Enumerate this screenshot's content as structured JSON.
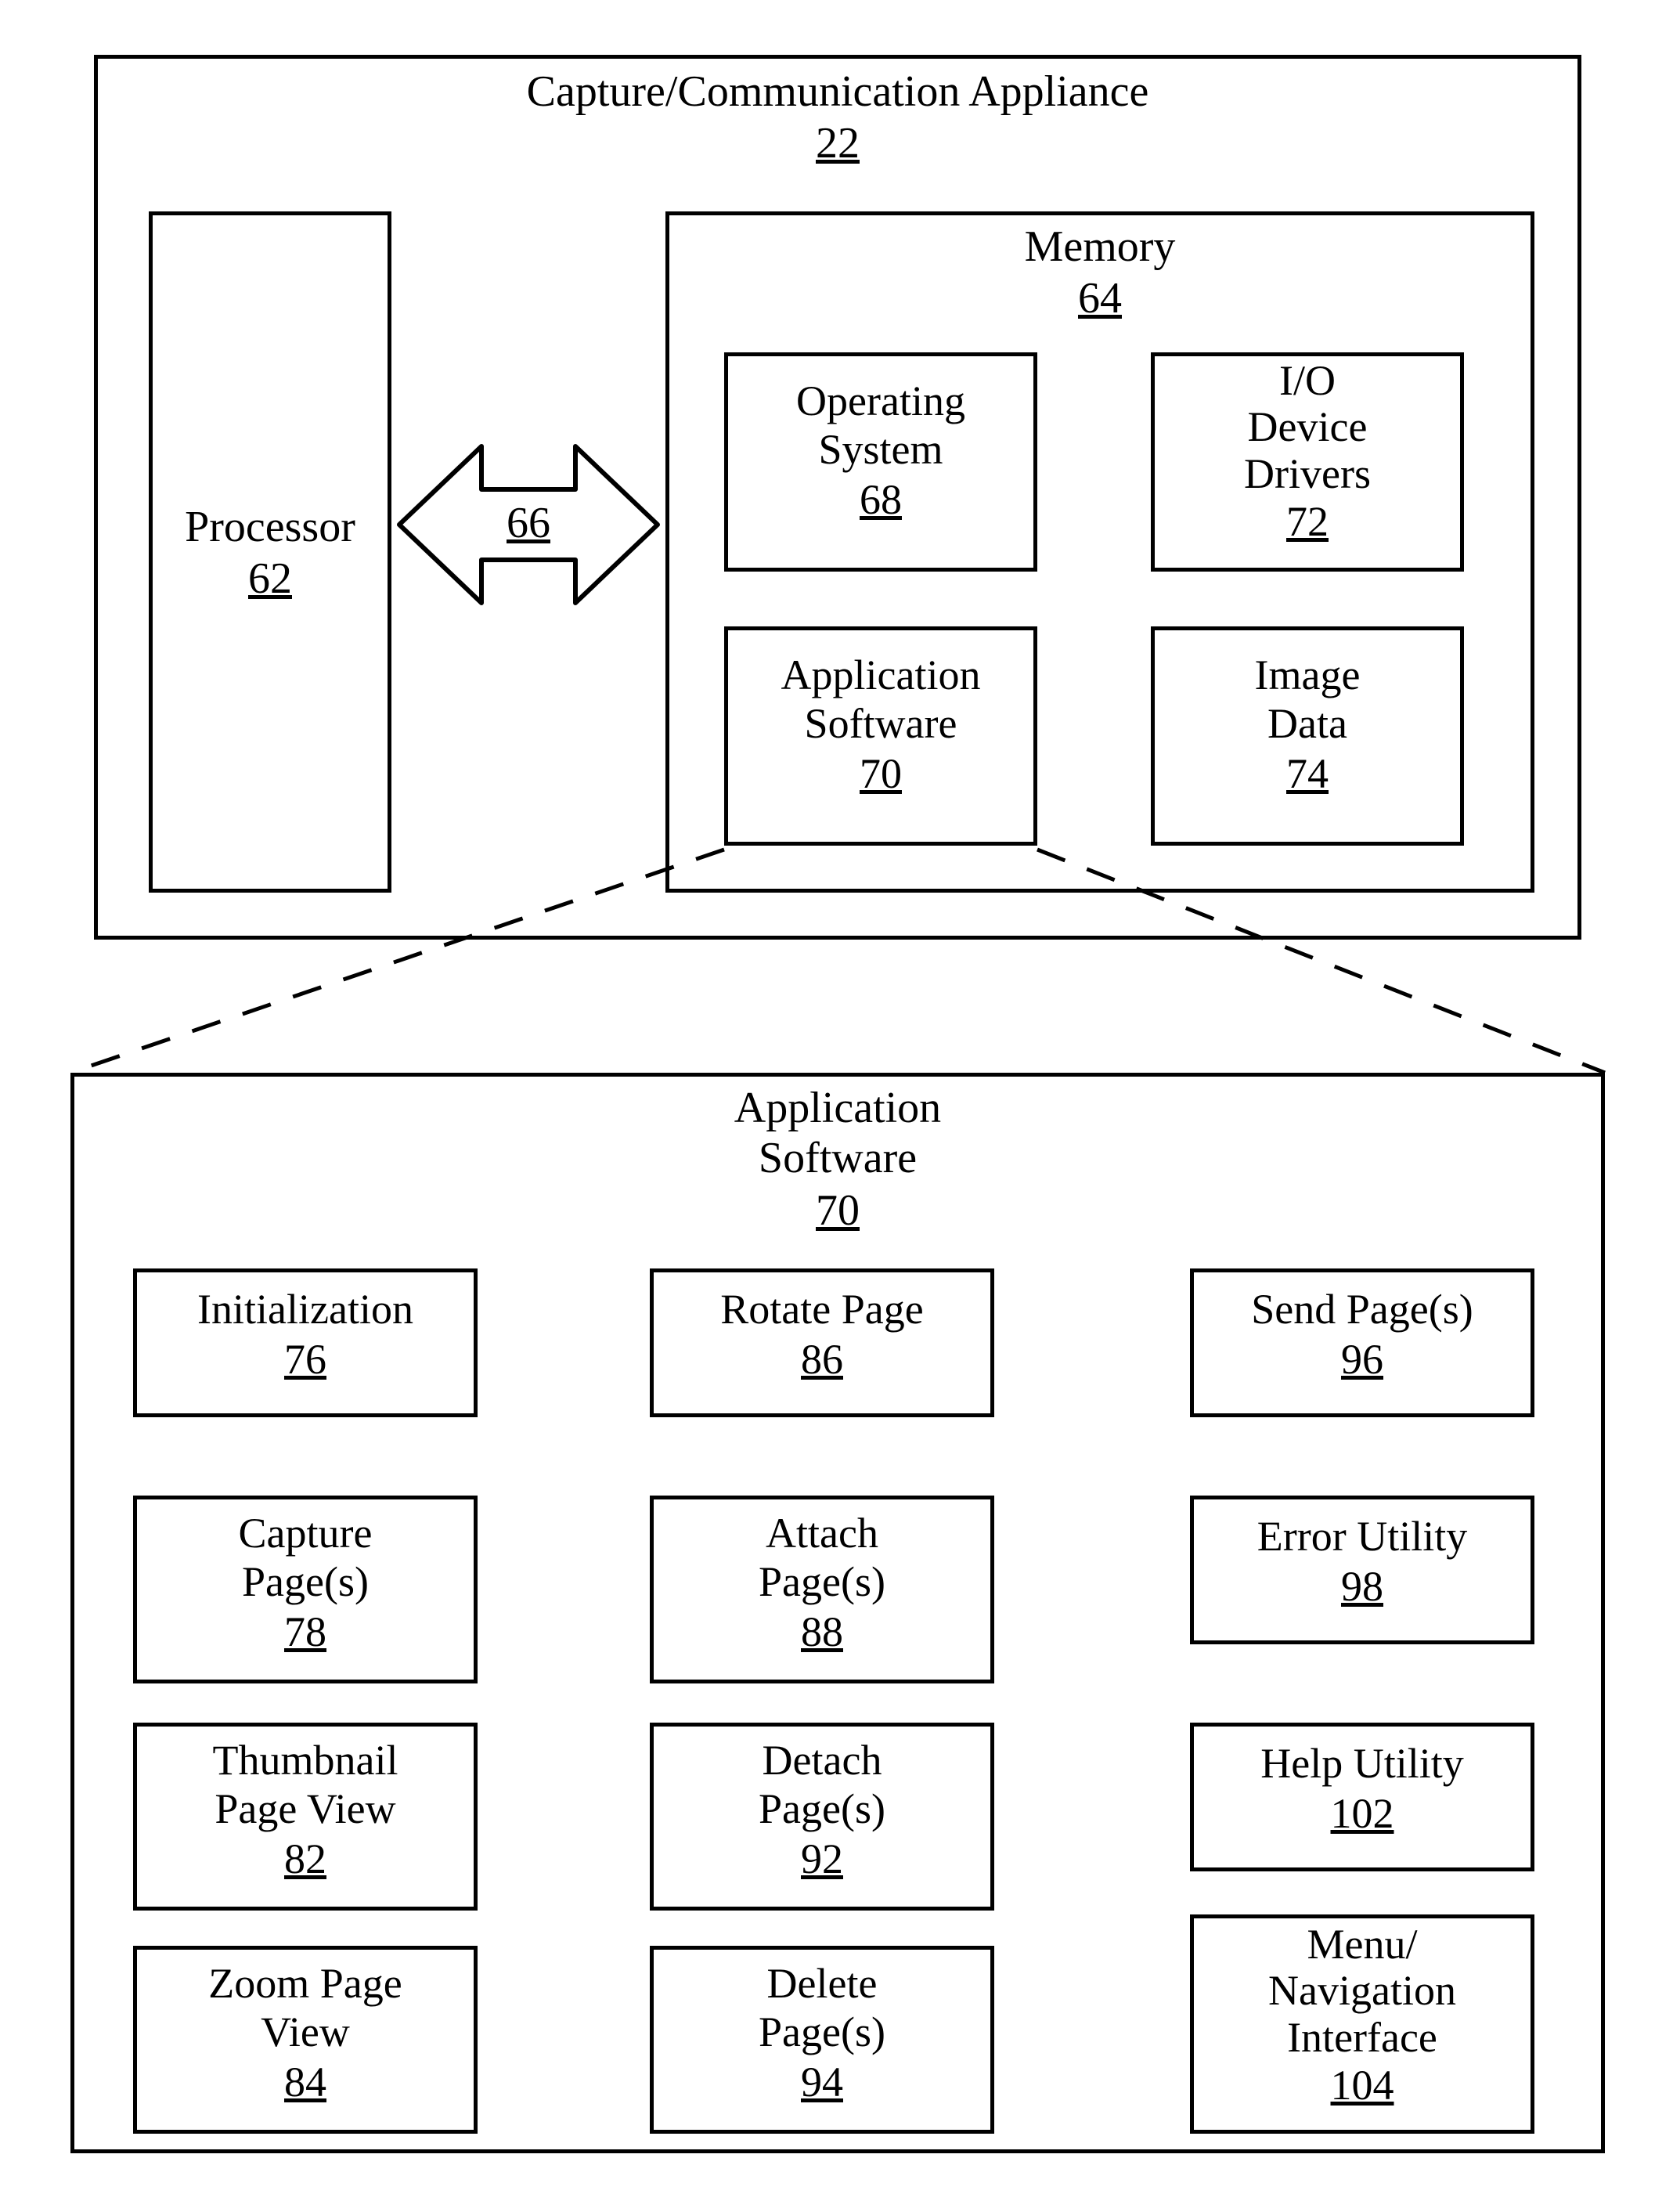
{
  "top": {
    "title": "Capture/Communication Appliance",
    "ref": "22",
    "processor": {
      "label": "Processor",
      "ref": "62"
    },
    "bus_ref": "66",
    "memory": {
      "label": "Memory",
      "ref": "64",
      "os": {
        "label1": "Operating",
        "label2": "System",
        "ref": "68"
      },
      "io": {
        "label1": "I/O",
        "label2": "Device",
        "label3": "Drivers",
        "ref": "72"
      },
      "appsoft": {
        "label1": "Application",
        "label2": "Software",
        "ref": "70"
      },
      "imagedata": {
        "label1": "Image",
        "label2": "Data",
        "ref": "74"
      }
    }
  },
  "bottom": {
    "title1": "Application",
    "title2": "Software",
    "ref": "70",
    "col1": [
      {
        "l1": "Initialization",
        "l2": "",
        "ref": "76"
      },
      {
        "l1": "Capture",
        "l2": "Page(s)",
        "ref": "78"
      },
      {
        "l1": "Thumbnail",
        "l2": "Page View",
        "ref": "82"
      },
      {
        "l1": "Zoom Page",
        "l2": "View",
        "ref": "84"
      }
    ],
    "col2": [
      {
        "l1": "Rotate Page",
        "l2": "",
        "ref": "86"
      },
      {
        "l1": "Attach",
        "l2": "Page(s)",
        "ref": "88"
      },
      {
        "l1": "Detach",
        "l2": "Page(s)",
        "ref": "92"
      },
      {
        "l1": "Delete",
        "l2": "Page(s)",
        "ref": "94"
      }
    ],
    "col3": [
      {
        "l1": "Send Page(s)",
        "l2": "",
        "ref": "96"
      },
      {
        "l1": "Error Utility",
        "l2": "",
        "ref": "98"
      },
      {
        "l1": "Help Utility",
        "l2": "",
        "ref": "102"
      },
      {
        "l1": "Menu/",
        "l2": "Navigation",
        "l3": "Interface",
        "ref": "104"
      }
    ]
  }
}
